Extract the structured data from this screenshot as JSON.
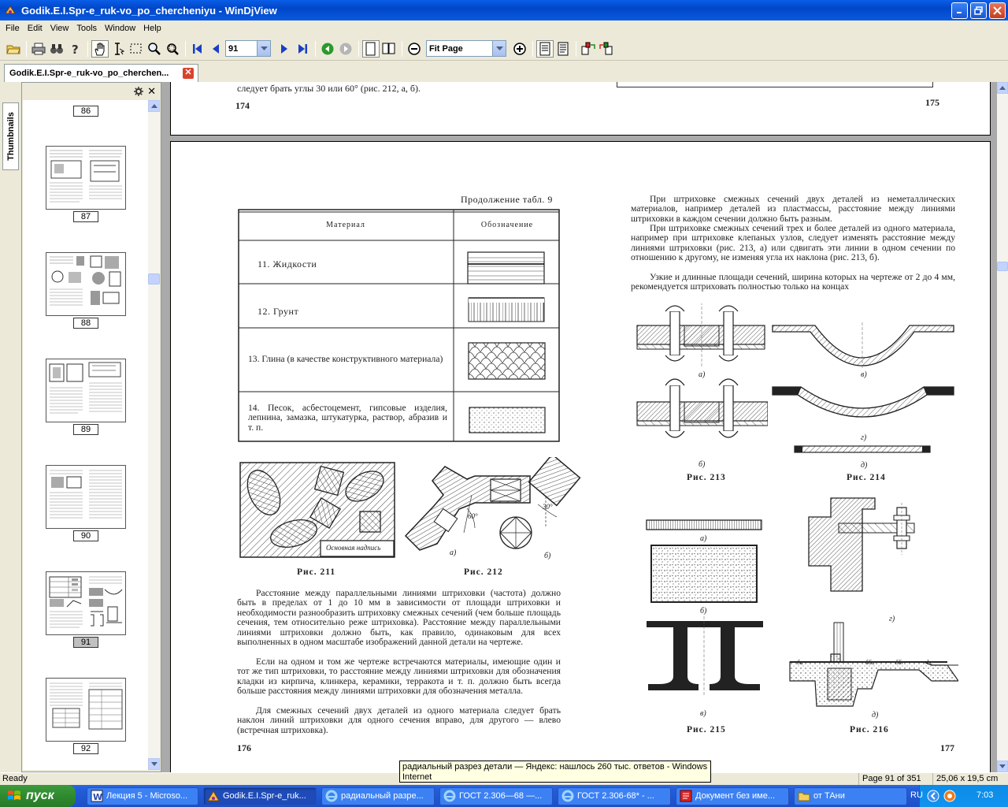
{
  "window": {
    "title": "Godik.E.I.Spr-e_ruk-vo_po_chercheniyu - WinDjView"
  },
  "menu": [
    "File",
    "Edit",
    "View",
    "Tools",
    "Window",
    "Help"
  ],
  "toolbar": {
    "page_value": "91",
    "zoom_value": "Fit Page"
  },
  "tab": {
    "label": "Godik.E.I.Spr-e_ruk-vo_po_cherchen..."
  },
  "sidebar": {
    "tab_label": "Thumbnails",
    "thumbnails": [
      "86",
      "87",
      "88",
      "89",
      "90",
      "91",
      "92"
    ],
    "selected": "91"
  },
  "doc": {
    "top_page": {
      "left_tail": "следует брать углы 30 или 60° (рис. 212, а, б).",
      "left_num": "174",
      "right_num": "175"
    },
    "left_page": {
      "continuation": "Продолжение табл. 9",
      "table_headers": [
        "Материал",
        "Обозначение"
      ],
      "rows": [
        "11. Жидкости",
        "12. Грунт",
        "13. Глина (в качестве конструктивного материала)",
        "14. Песок, асбестоцемент, гипсовые изделия, лепнина, замазка, штукатурка, раствор, абразив и т. п."
      ],
      "fig211_label": "Основная надпись",
      "fig_a": "а)",
      "fig_b": "б)",
      "angle_60": "60°",
      "angle_30": "30°",
      "cap_211": "Рис. 211",
      "cap_212": "Рис. 212",
      "para1": "Расстояние между параллельными линиями штриховки (частота) должно быть в пределах от 1 до 10 мм в зависимости от площади штриховки и необходимости разнообразить штриховку смежных сечений (чем больше площадь сечения, тем относительно реже штриховка). Расстояние между параллельными линиями штриховки должно быть, как правило, одинаковым для всех выполненных в одном масштабе изображений данной детали на чертеже.",
      "para2": "Если на одном и том же чертеже встречаются материалы, имеющие один и тот же тип штриховки, то расстояние между линиями штриховки для обозначения кладки из кирпича, клинкера, керамики, терракота и т. п. должно быть всегда больше расстояния между линиями штриховки для обозначения металла.",
      "para3": "Для смежных сечений двух деталей из одного материала следует брать наклон линий штриховки для одного сечения вправо, для другого — влево (встречная штриховка).",
      "page_num": "176"
    },
    "right_page": {
      "para1": "При штриховке смежных сечений двух деталей из неметаллических материалов, например деталей из пластмассы, расстояние между линиями штриховки в каждом сечении должно быть разным.",
      "para2": "При штриховке смежных сечений трех и более деталей из одного материала, например при штриховке клепаных узлов, следует изменять расстояние между линиями штриховки (рис. 213, а) или сдвигать эти линии в одном сечении по отношению к другому, не изменяя угла их наклона (рис. 213, б).",
      "para3": "Узкие и длинные площади сечений, ширина которых на чертеже от 2 до 4 мм, рекомендуется штриховать полностью только на концах",
      "fig_a": "а)",
      "fig_b": "б)",
      "fig_v": "в)",
      "fig_g": "г)",
      "fig_d": "д)",
      "cap_213": "Рис. 213",
      "cap_214": "Рис. 214",
      "cap_215": "Рис. 215",
      "cap_216": "Рис. 216",
      "dim_labels": [
        "δa",
        "δδa",
        "δδr",
        "bc"
      ],
      "page_num": "177"
    }
  },
  "status": {
    "ready": "Ready",
    "page_info": "Page 91 of 351",
    "page_size": "25,06 x 19,5 cm"
  },
  "tooltip": "радиальный разрез детали — Яндекс: нашлось 260 тыс. ответов - Windows Internet",
  "taskbar": {
    "start": "пуск",
    "tasks": [
      "Лекция 5 - Microso...",
      "Godik.E.I.Spr-e_ruk...",
      "радиальный разре...",
      "ГОСТ 2.306—68 —...",
      "ГОСТ 2.306-68* - ...",
      "Документ без име...",
      "от ТАни"
    ],
    "lang": "RU",
    "clock": "7:03"
  }
}
